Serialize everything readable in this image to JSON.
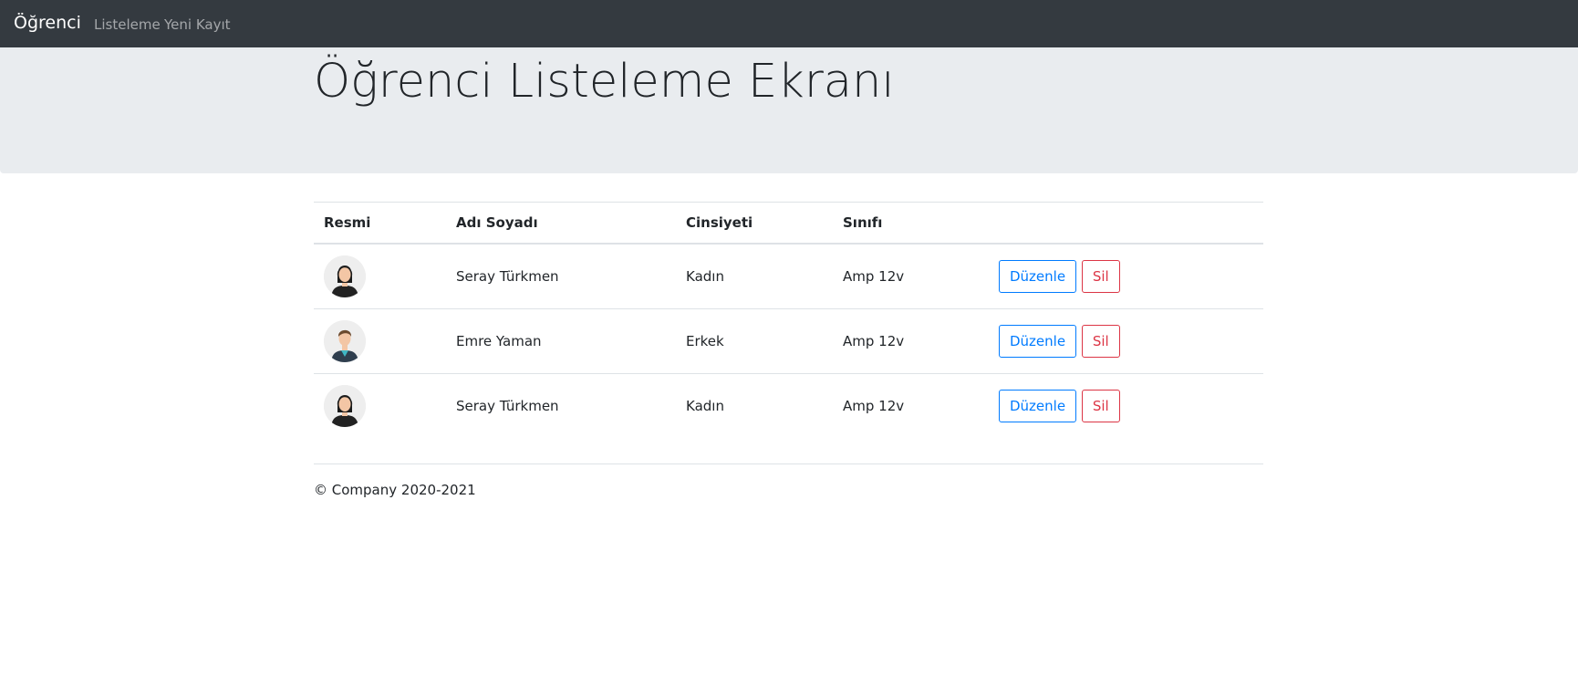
{
  "navbar": {
    "brand": "Öğrenci",
    "links": [
      "Listeleme",
      "Yeni Kayıt"
    ]
  },
  "jumbotron": {
    "title": "Öğrenci Listeleme Ekranı"
  },
  "table": {
    "headers": [
      "Resmi",
      "Adı Soyadı",
      "Cinsiyeti",
      "Sınıfı",
      ""
    ],
    "rows": [
      {
        "avatar": "female-avatar-icon",
        "name": "Seray Türkmen",
        "gender": "Kadın",
        "class": "Amp 12v",
        "edit": "Düzenle",
        "delete": "Sil"
      },
      {
        "avatar": "male-avatar-icon",
        "name": "Emre Yaman",
        "gender": "Erkek",
        "class": "Amp 12v",
        "edit": "Düzenle",
        "delete": "Sil"
      },
      {
        "avatar": "female-avatar-icon",
        "name": "Seray Türkmen",
        "gender": "Kadın",
        "class": "Amp 12v",
        "edit": "Düzenle",
        "delete": "Sil"
      }
    ]
  },
  "footer": {
    "text": "© Company 2020-2021"
  },
  "colors": {
    "navbar_bg": "#343a40",
    "jumbotron_bg": "#e9ecef",
    "primary": "#007bff",
    "danger": "#dc3545"
  }
}
